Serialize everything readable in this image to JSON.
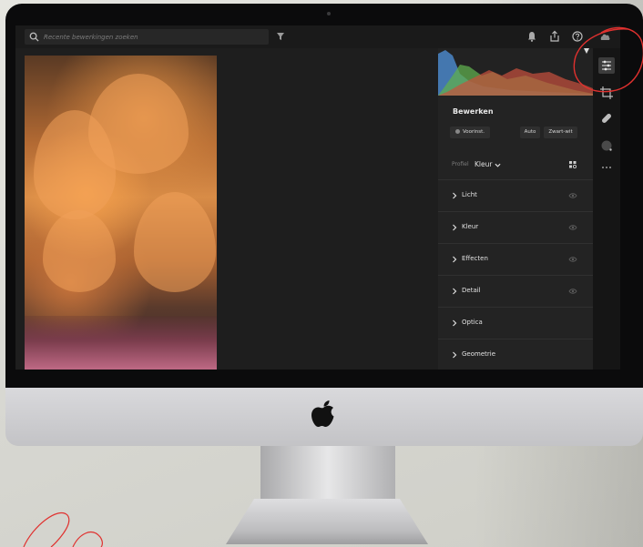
{
  "search": {
    "placeholder": "Recente bewerkingen zoeken"
  },
  "edit_panel": {
    "title": "Bewerken",
    "preset_button": "Voorinst.",
    "auto_button": "Auto",
    "bw_button": "Zwart-wit",
    "profile_label": "Profiel",
    "profile_value": "Kleur",
    "sections": [
      "Licht",
      "Kleur",
      "Effecten",
      "Detail",
      "Optica",
      "Geometrie"
    ]
  },
  "colors": {
    "annotation_red": "#e0312f",
    "panel_bg": "#232323",
    "screen_bg": "#1e1e1e",
    "histogram_blue": "#4a86c8",
    "histogram_green": "#5fae4e",
    "histogram_red": "#c9503d"
  },
  "icons": {
    "topbar": [
      "search-icon",
      "filter-icon",
      "bell-icon",
      "share-icon",
      "help-icon",
      "cloud-icon"
    ],
    "toolstrip": [
      "sliders-icon",
      "crop-icon",
      "bandage-icon",
      "masking-icon",
      "more-icon"
    ]
  }
}
